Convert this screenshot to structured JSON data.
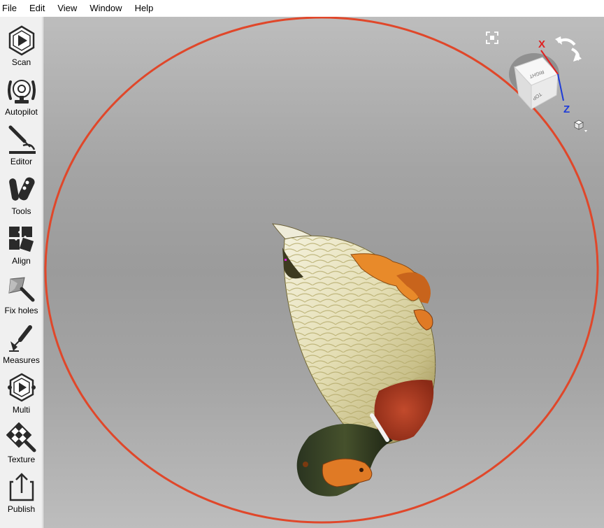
{
  "menu": [
    "File",
    "Edit",
    "View",
    "Window",
    "Help"
  ],
  "tools": [
    {
      "label": "Scan",
      "icon": "scan-icon"
    },
    {
      "label": "Autopilot",
      "icon": "autopilot-icon"
    },
    {
      "label": "Editor",
      "icon": "editor-icon"
    },
    {
      "label": "Tools",
      "icon": "tools-icon"
    },
    {
      "label": "Align",
      "icon": "align-icon"
    },
    {
      "label": "Fix holes",
      "icon": "fix-holes-icon"
    },
    {
      "label": "Measures",
      "icon": "measures-icon"
    },
    {
      "label": "Multi",
      "icon": "multi-icon"
    },
    {
      "label": "Texture",
      "icon": "texture-icon"
    },
    {
      "label": "Publish",
      "icon": "publish-icon"
    }
  ],
  "view_cube": {
    "faces": [
      "RIGHT",
      "TOP"
    ],
    "axes": [
      "X",
      "Z"
    ]
  },
  "colors": {
    "boundary_circle": "#e0472a",
    "axis_x": "#e02020",
    "axis_z": "#1e3cd8"
  }
}
